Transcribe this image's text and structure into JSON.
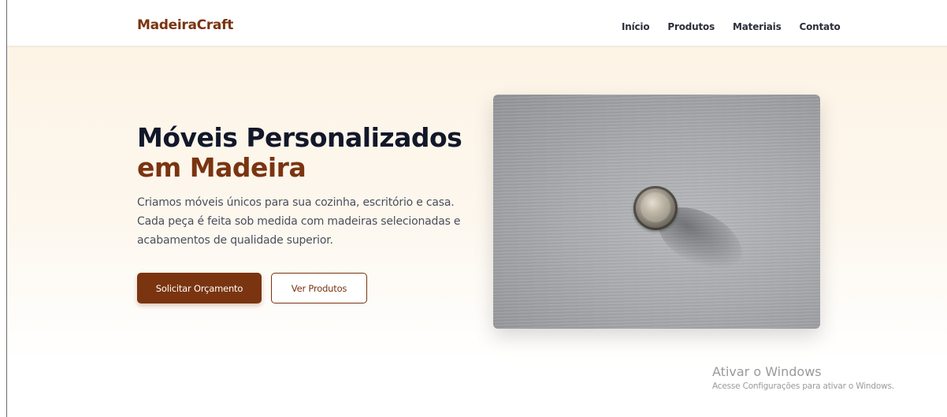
{
  "header": {
    "brand": "MadeiraCraft",
    "nav": [
      {
        "label": "Início"
      },
      {
        "label": "Produtos"
      },
      {
        "label": "Materiais"
      },
      {
        "label": "Contato"
      }
    ]
  },
  "hero": {
    "title_line1": "Móveis Personalizados",
    "title_line2": "em Madeira",
    "description": "Criamos móveis únicos para sua cozinha, escritório e casa. Cada peça é feita sob medida com madeiras selecionadas e acabamentos de qualidade superior.",
    "primary_button": "Solicitar Orçamento",
    "secondary_button": "Ver Produtos"
  },
  "watermark": {
    "title": "Ativar o Windows",
    "subtitle": "Acesse Configurações para ativar o Windows."
  },
  "colors": {
    "brand": "#7a3410",
    "heading": "#12172a",
    "hero_background": "#fdf4e6"
  },
  "icons": {
    "hero_image": "cabinet-knob-photo"
  }
}
